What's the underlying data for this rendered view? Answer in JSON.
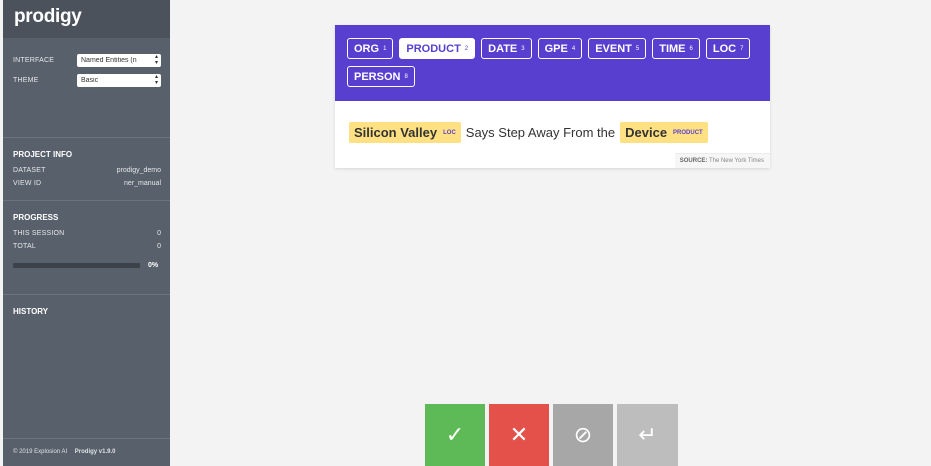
{
  "app": {
    "logo": "prodigy"
  },
  "settings": {
    "interface_label": "INTERFACE",
    "interface_value": "Named Entities (n",
    "theme_label": "THEME",
    "theme_value": "Basic"
  },
  "project_info": {
    "title": "PROJECT INFO",
    "dataset_label": "DATASET",
    "dataset_value": "prodigy_demo",
    "view_id_label": "VIEW ID",
    "view_id_value": "ner_manual"
  },
  "progress": {
    "title": "PROGRESS",
    "session_label": "THIS SESSION",
    "session_value": "0",
    "total_label": "TOTAL",
    "total_value": "0",
    "percent_text": "0%",
    "fraction": 0
  },
  "history": {
    "title": "HISTORY"
  },
  "footer": {
    "copyright": "© 2019 Explosion AI",
    "version": "Prodigy v1.9.0"
  },
  "labels": [
    {
      "name": "ORG",
      "key": "1"
    },
    {
      "name": "PRODUCT",
      "key": "2"
    },
    {
      "name": "DATE",
      "key": "3"
    },
    {
      "name": "GPE",
      "key": "4"
    },
    {
      "name": "EVENT",
      "key": "5"
    },
    {
      "name": "TIME",
      "key": "6"
    },
    {
      "name": "LOC",
      "key": "7"
    },
    {
      "name": "PERSON",
      "key": "8"
    }
  ],
  "task": {
    "entity1_text": "Silicon Valley",
    "entity1_label": "LOC",
    "middle_text": "Says Step Away From the",
    "entity2_text": "Device",
    "entity2_label": "PRODUCT",
    "source_label": "SOURCE:",
    "source_value": "The New York Times"
  },
  "actions": {
    "accept_icon": "check-icon",
    "reject_icon": "x-icon",
    "ignore_icon": "ban-icon",
    "undo_icon": "undo-icon",
    "accept_glyph": "✓",
    "reject_glyph": "✕",
    "ignore_glyph": "⊘",
    "undo_glyph": "↵"
  },
  "colors": {
    "sidebar": "#58606b",
    "label_bar": "#583fcf",
    "entity_highlight": "#ffe184",
    "accept": "#5eba57",
    "reject": "#e4514a",
    "ignore": "#a7a7a7",
    "undo": "#bdbdbd"
  }
}
